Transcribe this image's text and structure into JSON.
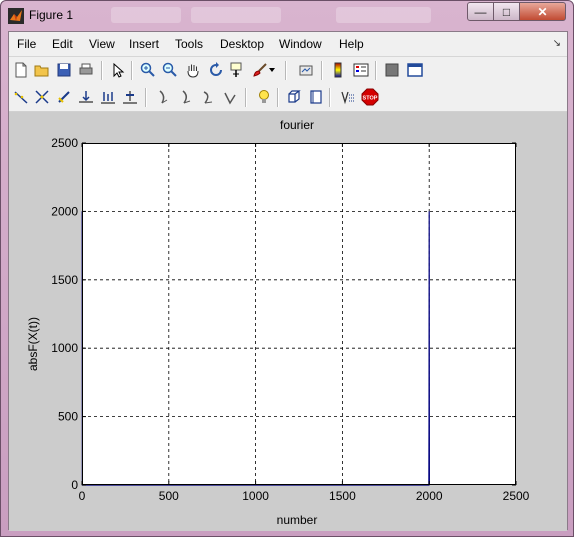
{
  "window": {
    "title": "Figure 1",
    "caption_buttons": {
      "minimize": "—",
      "maximize": "□",
      "close": "✕"
    }
  },
  "menu": [
    "File",
    "Edit",
    "View",
    "Insert",
    "Tools",
    "Desktop",
    "Window",
    "Help"
  ],
  "toolbar1": [
    {
      "name": "new-figure-icon"
    },
    {
      "name": "open-file-icon"
    },
    {
      "name": "save-icon"
    },
    {
      "name": "print-icon"
    },
    {
      "name": "edit-plot-arrow-icon"
    },
    {
      "name": "zoom-in-icon"
    },
    {
      "name": "zoom-out-icon"
    },
    {
      "name": "pan-hand-icon"
    },
    {
      "name": "rotate-3d-icon"
    },
    {
      "name": "data-cursor-icon"
    },
    {
      "name": "brush-icon"
    },
    {
      "name": "brush-dropdown-icon"
    },
    {
      "name": "link-plot-icon"
    },
    {
      "name": "colorbar-icon"
    },
    {
      "name": "legend-icon"
    },
    {
      "name": "hide-plot-tools-icon"
    },
    {
      "name": "show-plot-tools-icon"
    }
  ],
  "toolbar2": [
    {
      "name": "basic-fitting-icon"
    },
    {
      "name": "data-statistics-icon"
    },
    {
      "name": "pen-icon"
    },
    {
      "name": "align-icon"
    },
    {
      "name": "distribute-icon"
    },
    {
      "name": "axis-ruler-icon"
    },
    {
      "name": "line-tool-1-icon"
    },
    {
      "name": "line-tool-2-icon"
    },
    {
      "name": "line-tool-3-icon"
    },
    {
      "name": "line-tool-4-icon"
    },
    {
      "name": "light-bulb-icon"
    },
    {
      "name": "cube-icon"
    },
    {
      "name": "book-icon"
    },
    {
      "name": "matrix-icon"
    },
    {
      "name": "stop-icon"
    }
  ],
  "colors": {
    "series": "#00007f",
    "axes_bg": "#ffffff",
    "figure_bg": "#cccccc"
  },
  "chart_data": {
    "type": "line",
    "title": "fourier",
    "xlabel": "number",
    "ylabel": "absF(X(t))",
    "xlim": [
      0,
      2500
    ],
    "ylim": [
      0,
      2500
    ],
    "xticks": [
      0,
      500,
      1000,
      1500,
      2000,
      2500
    ],
    "yticks": [
      0,
      500,
      1000,
      1500,
      2000,
      2500
    ],
    "grid": true,
    "grid_style": "dashed",
    "series": [
      {
        "x": [
          1,
          2,
          3,
          1998,
          1999,
          2000,
          2001,
          2002
        ],
        "y": [
          2000,
          0,
          0,
          0,
          500,
          2000,
          0,
          0
        ]
      }
    ]
  }
}
